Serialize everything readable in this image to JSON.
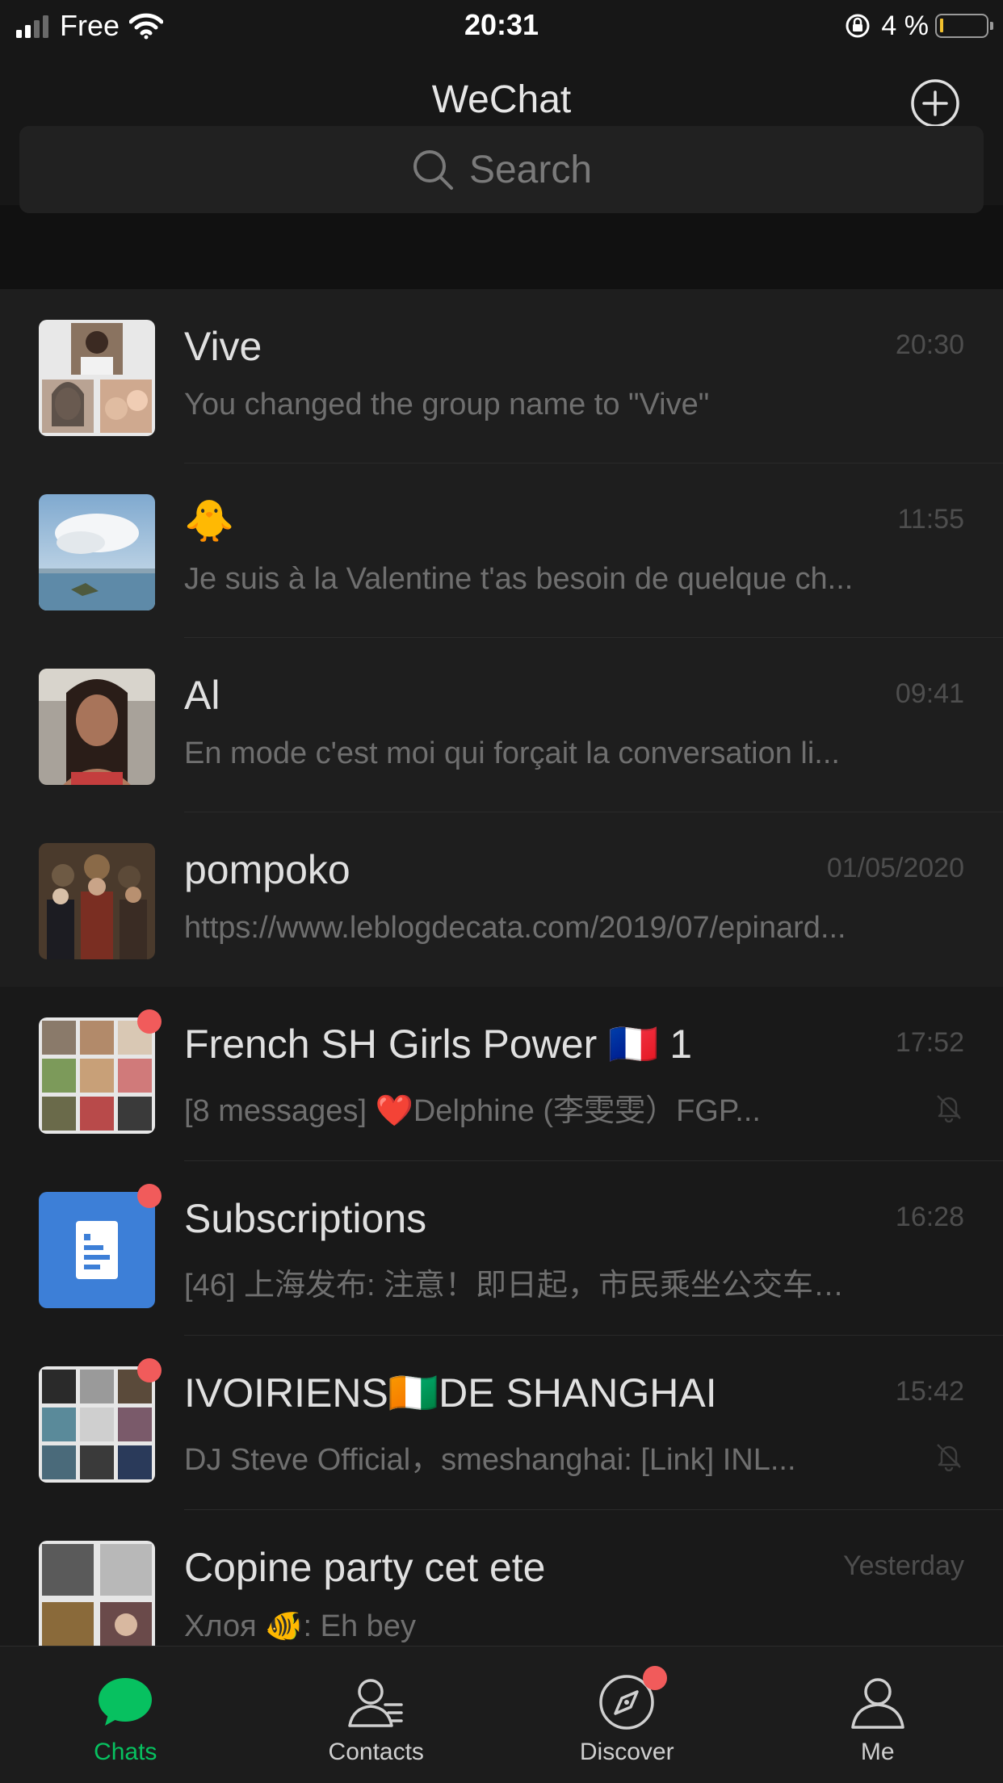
{
  "status_bar": {
    "carrier": "Free",
    "time": "20:31",
    "battery_percent": "4 %",
    "battery_level": 0.04,
    "signal_bars": 2
  },
  "header": {
    "title": "WeChat",
    "add_icon": "plus-circle-icon"
  },
  "search": {
    "placeholder": "Search",
    "icon": "search-icon"
  },
  "colors": {
    "accent": "#07c160",
    "badge": "#f15b5b",
    "subscriptions": "#3d7fd7"
  },
  "chats": [
    {
      "name": "Vive",
      "preview": "You changed the group name to \"Vive\"",
      "time": "20:30",
      "pinned": true,
      "unread_dot": false,
      "muted": false
    },
    {
      "name": "🐥",
      "preview": "Je suis à la Valentine t'as besoin de quelque ch...",
      "time": "11:55",
      "pinned": true,
      "unread_dot": false,
      "muted": false
    },
    {
      "name": "Al",
      "preview": "En mode c'est moi qui forçait la conversation li...",
      "time": "09:41",
      "pinned": true,
      "unread_dot": false,
      "muted": false
    },
    {
      "name": "pompoko",
      "preview": "https://www.leblogdecata.com/2019/07/epinard...",
      "time": "01/05/2020",
      "pinned": true,
      "unread_dot": false,
      "muted": false
    },
    {
      "name": "French SH Girls Power 🇫🇷 1",
      "preview": "[8 messages] ❤️Delphine (李雯雯）FGP...",
      "time": "17:52",
      "pinned": false,
      "unread_dot": true,
      "muted": true
    },
    {
      "name": "Subscriptions",
      "preview": "[46] 上海发布: 注意！即日起，市民乘坐公交车…",
      "time": "16:28",
      "pinned": false,
      "unread_dot": true,
      "muted": false
    },
    {
      "name": "IVOIRIENS🇨🇮DE SHANGHAI",
      "preview": "DJ Steve Official，smeshanghai: [Link] INL...",
      "time": "15:42",
      "pinned": false,
      "unread_dot": true,
      "muted": true
    },
    {
      "name": "Copine party cet ete",
      "preview": "Хлоя 🐠: Eh bey",
      "time": "Yesterday",
      "pinned": false,
      "unread_dot": false,
      "muted": false
    }
  ],
  "tabs": [
    {
      "label": "Chats",
      "icon": "chat-bubble-icon",
      "active": true,
      "dot": false
    },
    {
      "label": "Contacts",
      "icon": "contacts-icon",
      "active": false,
      "dot": false
    },
    {
      "label": "Discover",
      "icon": "compass-icon",
      "active": false,
      "dot": true
    },
    {
      "label": "Me",
      "icon": "person-icon",
      "active": false,
      "dot": false
    }
  ]
}
